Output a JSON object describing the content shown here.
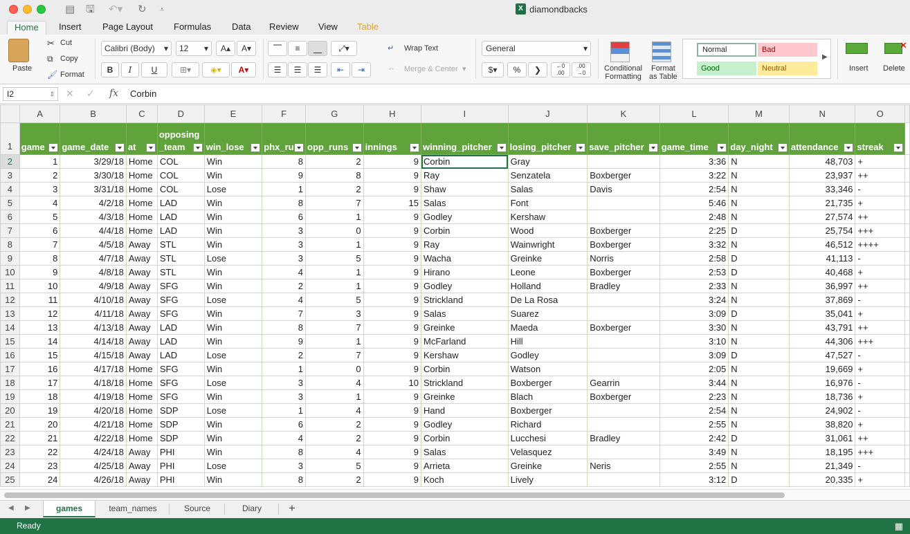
{
  "window": {
    "title": "diamondbacks"
  },
  "tabs": [
    {
      "label": "Home",
      "active": true
    },
    {
      "label": "Insert"
    },
    {
      "label": "Page Layout"
    },
    {
      "label": "Formulas"
    },
    {
      "label": "Data"
    },
    {
      "label": "Review"
    },
    {
      "label": "View"
    },
    {
      "label": "Table",
      "contextual": true
    }
  ],
  "ribbon": {
    "paste": "Paste",
    "cut": "Cut",
    "copy": "Copy",
    "format": "Format",
    "font_name": "Calibri (Body)",
    "font_size": "12",
    "bold": "B",
    "italic": "I",
    "underline": "U",
    "wrap_text": "Wrap Text",
    "merge_center": "Merge & Center",
    "number_format": "General",
    "currency": "$",
    "percent": "%",
    "conditional_formatting": [
      "Conditional",
      "Formatting"
    ],
    "format_as_table": [
      "Format",
      "as Table"
    ],
    "styles": {
      "normal": "Normal",
      "bad": "Bad",
      "good": "Good",
      "neutral": "Neutral"
    },
    "insert": "Insert",
    "delete": "Delete",
    "colors": {
      "bad_bg": "#ffc7ce",
      "bad_fg": "#9c0006",
      "good_bg": "#c6efce",
      "good_fg": "#006100",
      "neutral_bg": "#ffeb9c",
      "neutral_fg": "#9c5700"
    }
  },
  "formula_bar": {
    "cell_ref": "I2",
    "value": "Corbin"
  },
  "columns": [
    "A",
    "B",
    "C",
    "D",
    "E",
    "F",
    "G",
    "H",
    "I",
    "J",
    "K",
    "L",
    "M",
    "N",
    "O"
  ],
  "headers": [
    "game",
    "game_date",
    "at",
    "opposing\n_team",
    "win_lose",
    "phx_ru",
    "opp_runs",
    "innings",
    "winning_pitcher",
    "losing_pitcher",
    "save_pitcher",
    "game_time",
    "day_night",
    "attendance",
    "streak"
  ],
  "rows": [
    [
      "1",
      "3/29/18",
      "Home",
      "COL",
      "Win",
      "8",
      "2",
      "9",
      "Corbin",
      "Gray",
      "",
      "3:36",
      "N",
      "48,703",
      "+"
    ],
    [
      "2",
      "3/30/18",
      "Home",
      "COL",
      "Win",
      "9",
      "8",
      "9",
      "Ray",
      "Senzatela",
      "Boxberger",
      "3:22",
      "N",
      "23,937",
      "++"
    ],
    [
      "3",
      "3/31/18",
      "Home",
      "COL",
      "Lose",
      "1",
      "2",
      "9",
      "Shaw",
      "Salas",
      "Davis",
      "2:54",
      "N",
      "33,346",
      "-"
    ],
    [
      "4",
      "4/2/18",
      "Home",
      "LAD",
      "Win",
      "8",
      "7",
      "15",
      "Salas",
      "Font",
      "",
      "5:46",
      "N",
      "21,735",
      "+"
    ],
    [
      "5",
      "4/3/18",
      "Home",
      "LAD",
      "Win",
      "6",
      "1",
      "9",
      "Godley",
      "Kershaw",
      "",
      "2:48",
      "N",
      "27,574",
      "++"
    ],
    [
      "6",
      "4/4/18",
      "Home",
      "LAD",
      "Win",
      "3",
      "0",
      "9",
      "Corbin",
      "Wood",
      "Boxberger",
      "2:25",
      "D",
      "25,754",
      "+++"
    ],
    [
      "7",
      "4/5/18",
      "Away",
      "STL",
      "Win",
      "3",
      "1",
      "9",
      "Ray",
      "Wainwright",
      "Boxberger",
      "3:32",
      "N",
      "46,512",
      "++++"
    ],
    [
      "8",
      "4/7/18",
      "Away",
      "STL",
      "Lose",
      "3",
      "5",
      "9",
      "Wacha",
      "Greinke",
      "Norris",
      "2:58",
      "D",
      "41,113",
      "-"
    ],
    [
      "9",
      "4/8/18",
      "Away",
      "STL",
      "Win",
      "4",
      "1",
      "9",
      "Hirano",
      "Leone",
      "Boxberger",
      "2:53",
      "D",
      "40,468",
      "+"
    ],
    [
      "10",
      "4/9/18",
      "Away",
      "SFG",
      "Win",
      "2",
      "1",
      "9",
      "Godley",
      "Holland",
      "Bradley",
      "2:33",
      "N",
      "36,997",
      "++"
    ],
    [
      "11",
      "4/10/18",
      "Away",
      "SFG",
      "Lose",
      "4",
      "5",
      "9",
      "Strickland",
      "De La Rosa",
      "",
      "3:24",
      "N",
      "37,869",
      "-"
    ],
    [
      "12",
      "4/11/18",
      "Away",
      "SFG",
      "Win",
      "7",
      "3",
      "9",
      "Salas",
      "Suarez",
      "",
      "3:09",
      "D",
      "35,041",
      "+"
    ],
    [
      "13",
      "4/13/18",
      "Away",
      "LAD",
      "Win",
      "8",
      "7",
      "9",
      "Greinke",
      "Maeda",
      "Boxberger",
      "3:30",
      "N",
      "43,791",
      "++"
    ],
    [
      "14",
      "4/14/18",
      "Away",
      "LAD",
      "Win",
      "9",
      "1",
      "9",
      "McFarland",
      "Hill",
      "",
      "3:10",
      "N",
      "44,306",
      "+++"
    ],
    [
      "15",
      "4/15/18",
      "Away",
      "LAD",
      "Lose",
      "2",
      "7",
      "9",
      "Kershaw",
      "Godley",
      "",
      "3:09",
      "D",
      "47,527",
      "-"
    ],
    [
      "16",
      "4/17/18",
      "Home",
      "SFG",
      "Win",
      "1",
      "0",
      "9",
      "Corbin",
      "Watson",
      "",
      "2:05",
      "N",
      "19,669",
      "+"
    ],
    [
      "17",
      "4/18/18",
      "Home",
      "SFG",
      "Lose",
      "3",
      "4",
      "10",
      "Strickland",
      "Boxberger",
      "Gearrin",
      "3:44",
      "N",
      "16,976",
      "-"
    ],
    [
      "18",
      "4/19/18",
      "Home",
      "SFG",
      "Win",
      "3",
      "1",
      "9",
      "Greinke",
      "Blach",
      "Boxberger",
      "2:23",
      "N",
      "18,736",
      "+"
    ],
    [
      "19",
      "4/20/18",
      "Home",
      "SDP",
      "Lose",
      "1",
      "4",
      "9",
      "Hand",
      "Boxberger",
      "",
      "2:54",
      "N",
      "24,902",
      "-"
    ],
    [
      "20",
      "4/21/18",
      "Home",
      "SDP",
      "Win",
      "6",
      "2",
      "9",
      "Godley",
      "Richard",
      "",
      "2:55",
      "N",
      "38,820",
      "+"
    ],
    [
      "21",
      "4/22/18",
      "Home",
      "SDP",
      "Win",
      "4",
      "2",
      "9",
      "Corbin",
      "Lucchesi",
      "Bradley",
      "2:42",
      "D",
      "31,061",
      "++"
    ],
    [
      "22",
      "4/24/18",
      "Away",
      "PHI",
      "Win",
      "8",
      "4",
      "9",
      "Salas",
      "Velasquez",
      "",
      "3:49",
      "N",
      "18,195",
      "+++"
    ],
    [
      "23",
      "4/25/18",
      "Away",
      "PHI",
      "Lose",
      "3",
      "5",
      "9",
      "Arrieta",
      "Greinke",
      "Neris",
      "2:55",
      "N",
      "21,349",
      "-"
    ],
    [
      "24",
      "4/26/18",
      "Away",
      "PHI",
      "Win",
      "8",
      "2",
      "9",
      "Koch",
      "Lively",
      "",
      "3:12",
      "D",
      "20,335",
      "+"
    ]
  ],
  "sheets": [
    {
      "label": "games",
      "active": true
    },
    {
      "label": "team_names"
    },
    {
      "label": "Source"
    },
    {
      "label": "Diary"
    }
  ],
  "add_sheet": "+",
  "status": "Ready",
  "selection": {
    "row": 2,
    "col": "I"
  }
}
